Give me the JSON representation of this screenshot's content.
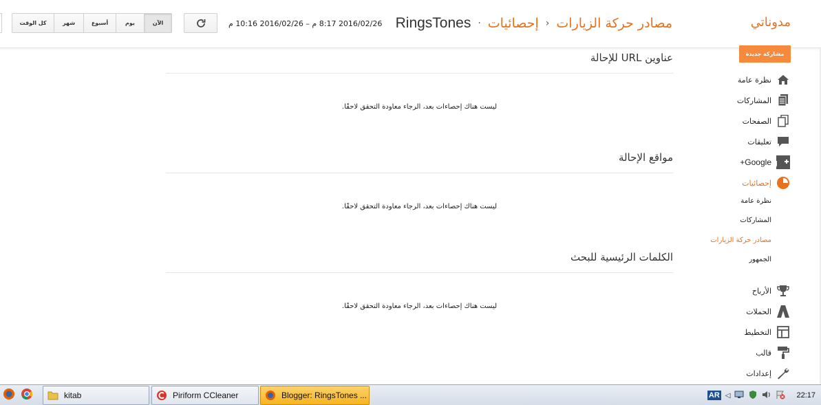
{
  "header": {
    "brand": "مدوناتي",
    "blog_name": "RingsTones",
    "crumb_stats": "إحصائيات",
    "crumb_current": "مصادر حركة الزيارات",
    "date_range": "2016/02/26 8:17 م – 2016/02/26 10:16 م",
    "range_buttons": [
      "الآن",
      "يوم",
      "أسبوع",
      "شهر",
      "كل الوقت"
    ]
  },
  "sidebar": {
    "new_post": "مشاركة جديدة",
    "items": [
      {
        "label": "نظرة عامة",
        "icon": "home-icon"
      },
      {
        "label": "المشاركات",
        "icon": "posts-icon"
      },
      {
        "label": "الصفحات",
        "icon": "pages-icon"
      },
      {
        "label": "تعليقات",
        "icon": "comments-icon"
      },
      {
        "label": "Google+",
        "icon": "google-plus-icon"
      },
      {
        "label": "إحصائيات",
        "icon": "stats-icon"
      },
      {
        "label": "الأرباح",
        "icon": "trophy-icon"
      },
      {
        "label": "الحملات",
        "icon": "adwords-icon"
      },
      {
        "label": "التخطيط",
        "icon": "layout-icon"
      },
      {
        "label": "قالب",
        "icon": "template-icon"
      },
      {
        "label": "إعدادات",
        "icon": "settings-icon"
      }
    ],
    "stats_sub": [
      "نظرة عامة",
      "المشاركات",
      "مصادر حركة الزيارات",
      "الجمهور"
    ]
  },
  "main": {
    "sections": [
      {
        "title": "عناوين URL للإحالة",
        "empty": "ليست هناك إحصاءات بعد، الرجاء معاودة التحقق لاحقًا."
      },
      {
        "title": "مواقع الإحالة",
        "empty": "ليست هناك إحصاءات بعد، الرجاء معاودة التحقق لاحقًا."
      },
      {
        "title": "الكلمات الرئيسية للبحث",
        "empty": "ليست هناك إحصاءات بعد، الرجاء معاودة التحقق لاحقًا."
      }
    ]
  },
  "taskbar": {
    "tasks": [
      "kitab",
      "Piriform CCleaner",
      "Blogger: RingsTones ..."
    ],
    "lang": "AR",
    "clock": "22:17"
  },
  "colors": {
    "accent": "#e8711c",
    "button_orange": "#f58a3c",
    "icon_gray": "#555555"
  }
}
